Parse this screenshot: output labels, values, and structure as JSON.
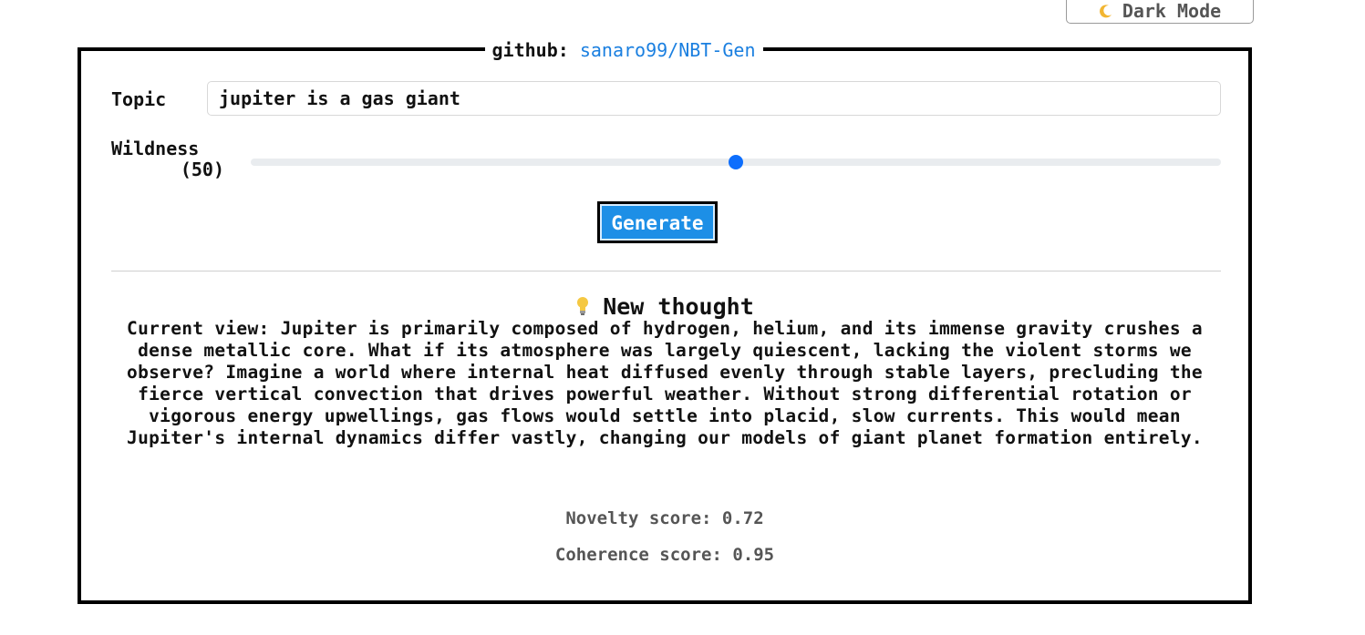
{
  "header": {
    "dark_mode_label": "Dark Mode",
    "dark_mode_icon": "moon-icon"
  },
  "panel": {
    "legend_prefix": "github:",
    "legend_link": "sanaro99/NBT-Gen"
  },
  "form": {
    "topic_label": "Topic",
    "topic_value": "jupiter is a gas giant",
    "wildness_label": "Wildness",
    "wildness_value_text": "(50)",
    "wildness_value": 50,
    "wildness_min": 0,
    "wildness_max": 100,
    "generate_label": "Generate"
  },
  "result": {
    "title_icon": "lightbulb-icon",
    "title": "New thought",
    "text": "Current view: Jupiter is primarily composed of hydrogen, helium, and its immense gravity crushes a dense metallic core. What if its atmosphere was largely quiescent, lacking the violent storms we observe? Imagine a world where internal heat diffused evenly through stable layers, precluding the fierce vertical convection that drives powerful weather. Without strong differential rotation or vigorous energy upwellings, gas flows would settle into placid, slow currents. This would mean Jupiter's internal dynamics differ vastly, changing our models of giant planet formation entirely.",
    "novelty_label": "Novelty score: 0.72",
    "coherence_label": "Coherence score: 0.95"
  },
  "colors": {
    "accent": "#1d8fe6",
    "link": "#1a7fe0",
    "slider_thumb": "#0d6efd"
  }
}
